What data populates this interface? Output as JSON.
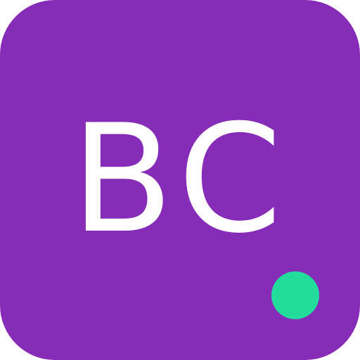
{
  "icon": {
    "initials": "BC",
    "background_color": "#862cb9",
    "text_color": "#ffffff",
    "status_dot_color": "#22dd9b"
  }
}
